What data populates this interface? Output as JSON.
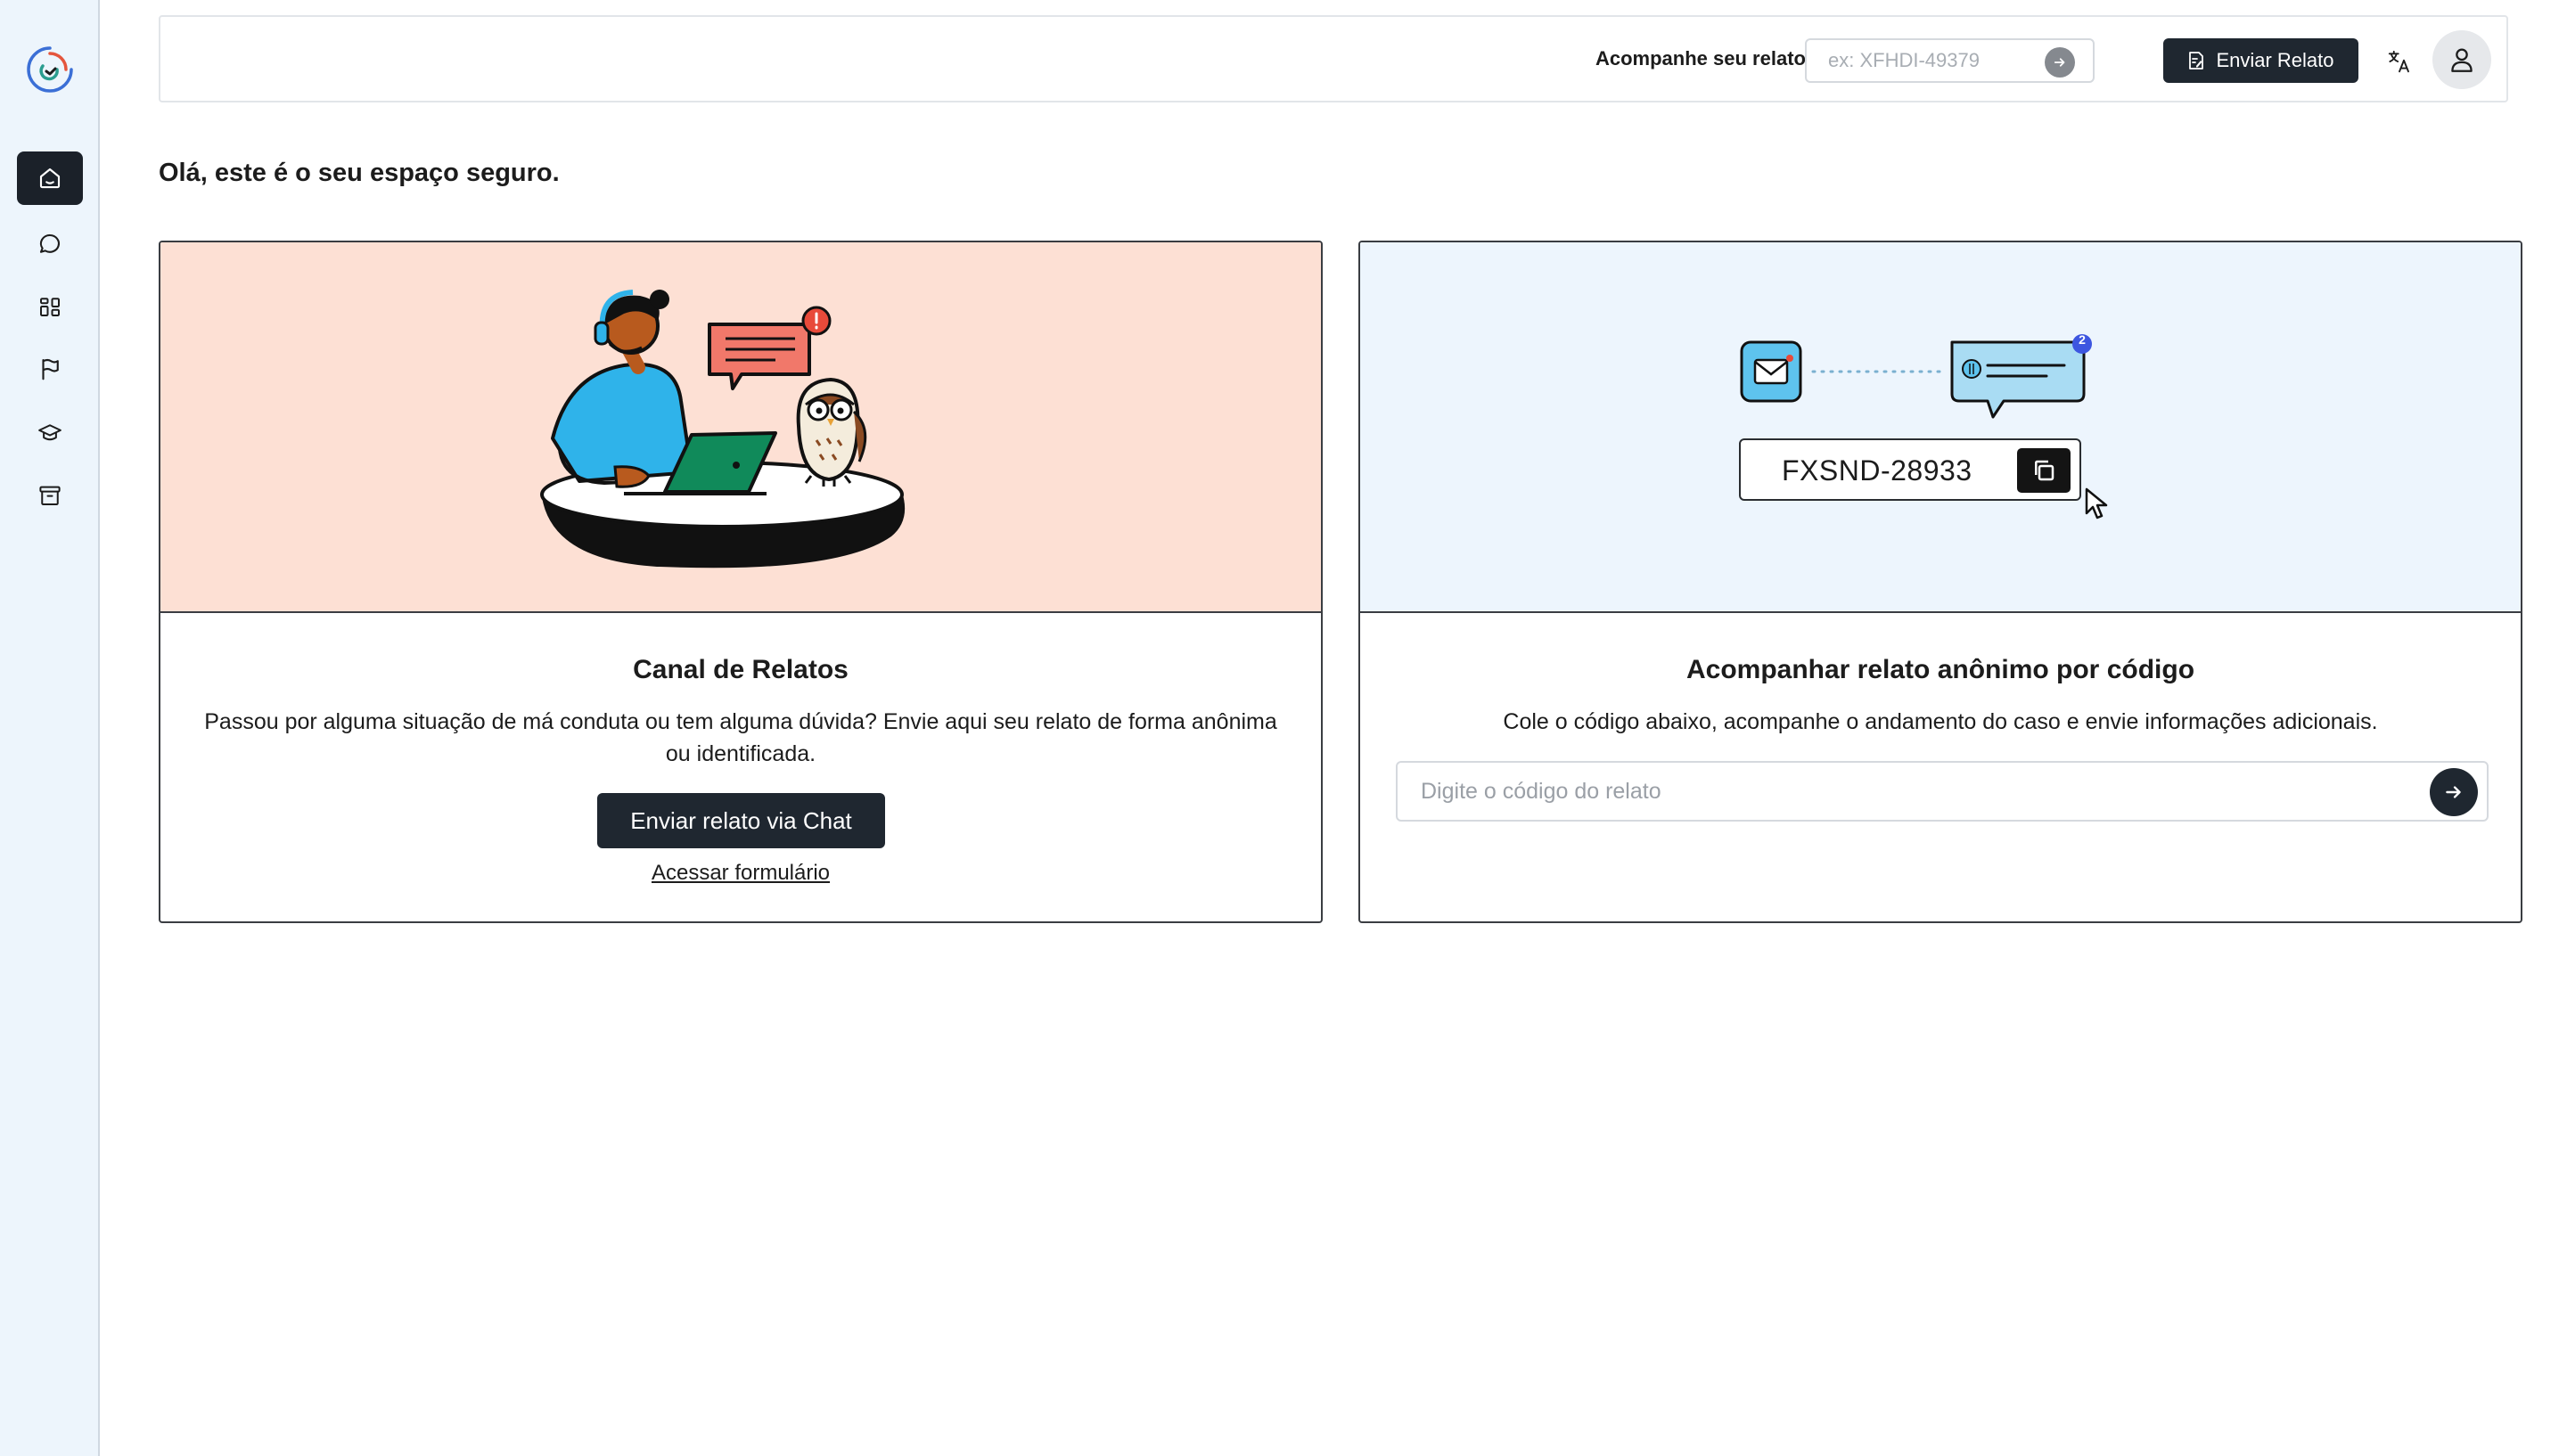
{
  "sidebar": {
    "logo": "brand-logo",
    "items": [
      {
        "name": "home-icon",
        "active": true
      },
      {
        "name": "chat-icon",
        "active": false
      },
      {
        "name": "board-icon",
        "active": false
      },
      {
        "name": "flag-icon",
        "active": false
      },
      {
        "name": "graduation-cap-icon",
        "active": false
      },
      {
        "name": "archive-icon",
        "active": false
      }
    ]
  },
  "header": {
    "track_label": "Acompanhe seu relato",
    "track_placeholder": "ex: XFHDI-49379",
    "send_button_label": "Enviar Relato",
    "language_icon": "translate-icon",
    "avatar_icon": "user-icon"
  },
  "greeting": "Olá, este é o seu espaço seguro.",
  "cards": {
    "report": {
      "title": "Canal de Relatos",
      "description": "Passou por alguma situação de má conduta ou tem alguma dúvida? Envie aqui seu relato de forma anônima ou identificada.",
      "chat_button_label": "Enviar relato via Chat",
      "form_link_label": "Acessar formulário"
    },
    "track": {
      "title": "Acompanhar relato anônimo por código",
      "description": "Cole o código abaixo, acompanhe o andamento do caso e envie informações adicionais.",
      "input_placeholder": "Digite o código do relato",
      "illustration_code": "FXSND-28933",
      "notification_count": "2"
    }
  },
  "colors": {
    "sidebar_bg": "#edf5fc",
    "dark_button": "#1f2730",
    "left_card_illus_bg": "#fde0d4",
    "right_card_illus_bg": "#edf5fd"
  }
}
